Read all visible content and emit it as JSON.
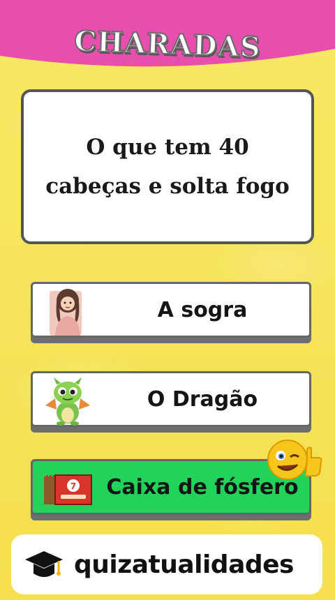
{
  "header": {
    "title": "CHARADAS"
  },
  "question": {
    "line1": "O que tem 40",
    "line2": "cabeças e solta fogo"
  },
  "options": [
    {
      "label": "A sogra",
      "icon": "woman-icon",
      "state": "default"
    },
    {
      "label": "O Dragão",
      "icon": "dragon-icon",
      "state": "default"
    },
    {
      "label": "Caixa de fósfero",
      "icon": "matchbox-icon",
      "state": "correct",
      "icon_text": "7"
    }
  ],
  "badge": {
    "icon": "winking-thumbs-up-emoji-icon"
  },
  "brand": {
    "name": "quizatualidades",
    "icon": "graduation-cap-icon"
  },
  "colors": {
    "background": "#f7e35a",
    "top_band": "#e64fae",
    "correct": "#22d35b",
    "card_border": "#555555"
  }
}
